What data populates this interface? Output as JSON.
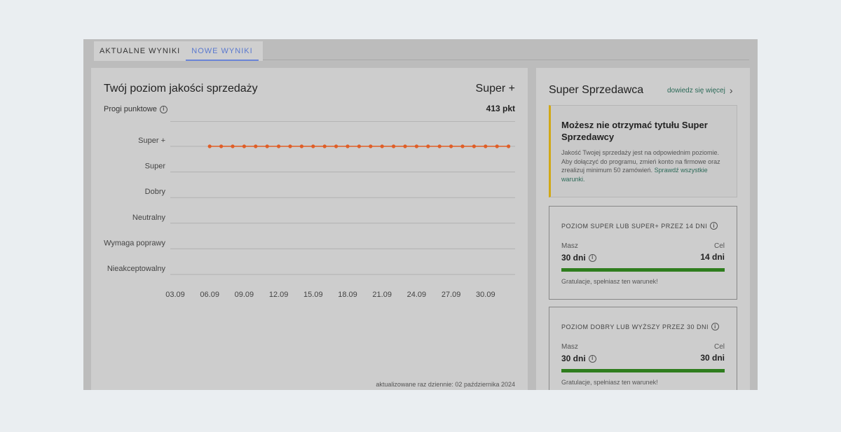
{
  "tabs": [
    {
      "label": "AKTUALNE WYNIKI",
      "active": false
    },
    {
      "label": "NOWE WYNIKI",
      "active": true
    }
  ],
  "chart_panel": {
    "title": "Twój poziom jakości sprzedaży",
    "current_level": "Super +",
    "thresholds_label": "Progi punktowe",
    "points": "413 pkt",
    "updated": "aktualizowane raz dziennie: 02 października 2024"
  },
  "chart_data": {
    "type": "line",
    "y_categories": [
      "Super +",
      "Super",
      "Dobry",
      "Neutralny",
      "Wymaga poprawy",
      "Nieakceptowalny"
    ],
    "x_tick_labels": [
      "03.09",
      "06.09",
      "09.09",
      "12.09",
      "15.09",
      "18.09",
      "21.09",
      "24.09",
      "27.09",
      "30.09"
    ],
    "series": [
      {
        "color": "#e05e27",
        "x": [
          "06.09",
          "07.09",
          "08.09",
          "09.09",
          "10.09",
          "11.09",
          "12.09",
          "13.09",
          "14.09",
          "15.09",
          "16.09",
          "17.09",
          "18.09",
          "19.09",
          "20.09",
          "21.09",
          "22.09",
          "23.09",
          "24.09",
          "25.09",
          "26.09",
          "27.09",
          "28.09",
          "29.09",
          "30.09",
          "01.10",
          "02.10"
        ],
        "y": [
          "Super +",
          "Super +",
          "Super +",
          "Super +",
          "Super +",
          "Super +",
          "Super +",
          "Super +",
          "Super +",
          "Super +",
          "Super +",
          "Super +",
          "Super +",
          "Super +",
          "Super +",
          "Super +",
          "Super +",
          "Super +",
          "Super +",
          "Super +",
          "Super +",
          "Super +",
          "Super +",
          "Super +",
          "Super +",
          "Super +",
          "Super +"
        ]
      }
    ]
  },
  "super_seller": {
    "title": "Super Sprzedawca",
    "more_link": "dowiedz się więcej",
    "warning": {
      "title": "Możesz nie otrzymać tytułu Super Sprzedawcy",
      "body": "Jakość Twojej sprzedaży jest na odpowiednim poziomie. Aby dołączyć do programu, zmień konto na firmowe oraz zrealizuj minimum 50 zamówień.",
      "link": "Sprawdź wszystkie warunki."
    },
    "conditions": [
      {
        "title": "POZIOM SUPER LUB SUPER+ PRZEZ 14 DNI",
        "have_label": "Masz",
        "have_value": "30 dni",
        "goal_label": "Cel",
        "goal_value": "14 dni",
        "progress": 1.0,
        "message": "Gratulacje, spełniasz ten warunek!"
      },
      {
        "title": "POZIOM DOBRY LUB WYŻSZY PRZEZ 30 DNI",
        "have_label": "Masz",
        "have_value": "30 dni",
        "goal_label": "Cel",
        "goal_value": "30 dni",
        "progress": 1.0,
        "message": "Gratulacje, spełniasz ten warunek!"
      }
    ]
  }
}
